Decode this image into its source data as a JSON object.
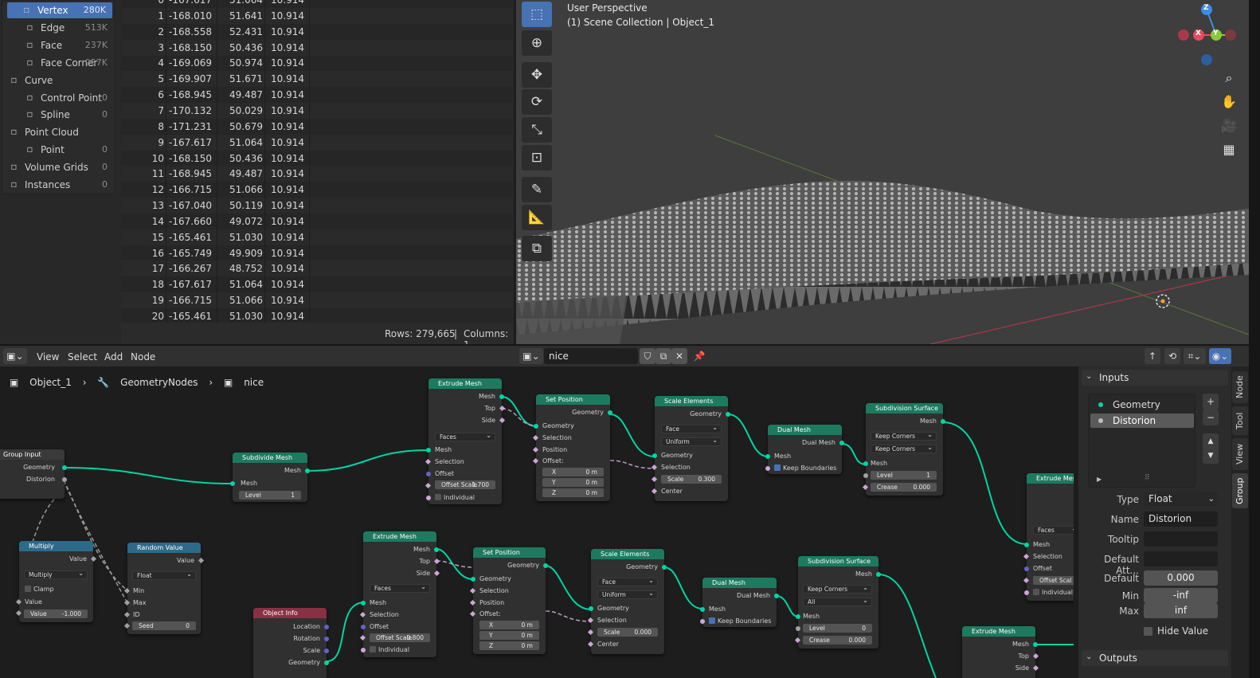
{
  "spreadsheet": {
    "domains": [
      {
        "label": "Vertex",
        "count": "280K",
        "icon": "vertex-icon",
        "indent": 1,
        "active": true
      },
      {
        "label": "Edge",
        "count": "513K",
        "icon": "edge-icon",
        "indent": 1
      },
      {
        "label": "Face",
        "count": "237K",
        "icon": "face-icon",
        "indent": 1
      },
      {
        "label": "Face Corner",
        "count": "957K",
        "icon": "face-corner-icon",
        "indent": 1
      },
      {
        "label": "Curve",
        "count": "",
        "icon": "curve-icon",
        "indent": 0
      },
      {
        "label": "Control Point",
        "count": "0",
        "icon": "control-point-icon",
        "indent": 1
      },
      {
        "label": "Spline",
        "count": "0",
        "icon": "spline-icon",
        "indent": 1
      },
      {
        "label": "Point Cloud",
        "count": "",
        "icon": "point-cloud-icon",
        "indent": 0
      },
      {
        "label": "Point",
        "count": "0",
        "icon": "point-icon",
        "indent": 1
      },
      {
        "label": "Volume Grids",
        "count": "0",
        "icon": "volume-icon",
        "indent": 0
      },
      {
        "label": "Instances",
        "count": "0",
        "icon": "instances-icon",
        "indent": 0
      }
    ],
    "rows": [
      [
        "0",
        "-167.617",
        "51.064",
        "10.914"
      ],
      [
        "1",
        "-168.010",
        "51.641",
        "10.914"
      ],
      [
        "2",
        "-168.558",
        "52.431",
        "10.914"
      ],
      [
        "3",
        "-168.150",
        "50.436",
        "10.914"
      ],
      [
        "4",
        "-169.069",
        "50.974",
        "10.914"
      ],
      [
        "5",
        "-169.907",
        "51.671",
        "10.914"
      ],
      [
        "6",
        "-168.945",
        "49.487",
        "10.914"
      ],
      [
        "7",
        "-170.132",
        "50.029",
        "10.914"
      ],
      [
        "8",
        "-171.231",
        "50.679",
        "10.914"
      ],
      [
        "9",
        "-167.617",
        "51.064",
        "10.914"
      ],
      [
        "10",
        "-168.150",
        "50.436",
        "10.914"
      ],
      [
        "11",
        "-168.945",
        "49.487",
        "10.914"
      ],
      [
        "12",
        "-166.715",
        "51.066",
        "10.914"
      ],
      [
        "13",
        "-167.040",
        "50.119",
        "10.914"
      ],
      [
        "14",
        "-167.660",
        "49.072",
        "10.914"
      ],
      [
        "15",
        "-165.461",
        "51.030",
        "10.914"
      ],
      [
        "16",
        "-165.749",
        "49.909",
        "10.914"
      ],
      [
        "17",
        "-166.267",
        "48.752",
        "10.914"
      ],
      [
        "18",
        "-167.617",
        "51.064",
        "10.914"
      ],
      [
        "19",
        "-166.715",
        "51.066",
        "10.914"
      ],
      [
        "20",
        "-165.461",
        "51.030",
        "10.914"
      ]
    ],
    "status_rows": "Rows: 279,665",
    "status_sep": "|",
    "status_cols": "Columns: 1"
  },
  "viewport": {
    "title": "User Perspective",
    "subtitle": "(1) Scene Collection | Object_1",
    "axis_x": "X",
    "axis_y": "Y",
    "axis_z": "Z",
    "colors": {
      "x": "#e44b5c",
      "y": "#8bc83a",
      "z": "#3b8ee8"
    }
  },
  "node_header": {
    "menus": [
      "View",
      "Select",
      "Add",
      "Node"
    ],
    "tree_name": "nice"
  },
  "breadcrumb": {
    "object": "Object_1",
    "modifier": "GeometryNodes",
    "tree": "nice"
  },
  "nodes": {
    "group_input": {
      "title": "Group Input",
      "out1": "Geometry",
      "out2": "Distorion"
    },
    "subdivide": {
      "title": "Subdivide Mesh",
      "out": "Mesh",
      "in": "Mesh",
      "level_k": "Level",
      "level_v": "1"
    },
    "extrude1": {
      "title": "Extrude Mesh",
      "out1": "Mesh",
      "out2": "Top",
      "out3": "Side",
      "mode": "Faces",
      "in1": "Mesh",
      "in2": "Selection",
      "in3": "Offset",
      "scale_k": "Offset Scale",
      "scale_v": "1.700",
      "individual": "Individual"
    },
    "setpos1": {
      "title": "Set Position",
      "out": "Geometry",
      "in1": "Geometry",
      "in2": "Selection",
      "in3": "Position",
      "in4": "Offset:",
      "x": "X",
      "y": "Y",
      "z": "Z",
      "xv": "0 m",
      "yv": "0 m",
      "zv": "0 m"
    },
    "scale1": {
      "title": "Scale Elements",
      "out": "Geometry",
      "dom": "Face",
      "mode": "Uniform",
      "in1": "Geometry",
      "in2": "Selection",
      "scale_k": "Scale",
      "scale_v": "0.300",
      "center": "Center"
    },
    "dual1": {
      "title": "Dual Mesh",
      "out": "Dual Mesh",
      "in": "Mesh",
      "keep": "Keep Boundaries"
    },
    "subsurf1": {
      "title": "Subdivision Surface",
      "out": "Mesh",
      "opt1": "Keep Corners",
      "opt2": "Keep Corners",
      "in": "Mesh",
      "level_k": "Level",
      "level_v": "1",
      "crease_k": "Crease",
      "crease_v": "0.000"
    },
    "extrude_r": {
      "title": "Extrude Mesh",
      "mode": "Faces",
      "in1": "Mesh",
      "in2": "Selection",
      "in3": "Offset",
      "scale_k": "Offset Scal",
      "individual": "Individual"
    },
    "multiply": {
      "title": "Multiply",
      "out": "Value",
      "op": "Multiply",
      "clamp": "Clamp",
      "in": "Value",
      "val_k": "Value",
      "val_v": "-1.000"
    },
    "random": {
      "title": "Random Value",
      "out": "Value",
      "type": "Float",
      "min": "Min",
      "max": "Max",
      "id": "ID",
      "seed_k": "Seed",
      "seed_v": "0"
    },
    "objinfo": {
      "title": "Object Info",
      "o1": "Location",
      "o2": "Rotation",
      "o3": "Scale",
      "o4": "Geometry"
    },
    "extrude2": {
      "title": "Extrude Mesh",
      "out1": "Mesh",
      "out2": "Top",
      "out3": "Side",
      "mode": "Faces",
      "in1": "Mesh",
      "in2": "Selection",
      "in3": "Offset",
      "scale_k": "Offset Scale",
      "scale_v": "-0.800",
      "individual": "Individual"
    },
    "setpos2": {
      "title": "Set Position",
      "out": "Geometry",
      "in1": "Geometry",
      "in2": "Selection",
      "in3": "Position",
      "in4": "Offset:",
      "x": "X",
      "y": "Y",
      "z": "Z",
      "xv": "0 m",
      "yv": "0 m",
      "zv": "0 m"
    },
    "scale2": {
      "title": "Scale Elements",
      "out": "Geometry",
      "dom": "Face",
      "mode": "Uniform",
      "in1": "Geometry",
      "in2": "Selection",
      "scale_k": "Scale",
      "scale_v": "0.000",
      "center": "Center"
    },
    "dual2": {
      "title": "Dual Mesh",
      "out": "Dual Mesh",
      "in": "Mesh",
      "keep": "Keep Boundaries"
    },
    "subsurf2": {
      "title": "Subdivision Surface",
      "out": "Mesh",
      "opt1": "Keep Corners",
      "opt2": "All",
      "in": "Mesh",
      "level_k": "Level",
      "level_v": "0",
      "crease_k": "Crease",
      "crease_v": "0.000"
    },
    "extrude3": {
      "title": "Extrude Mesh",
      "out1": "Mesh",
      "out2": "Top",
      "out3": "Side"
    }
  },
  "sidebar": {
    "inputs_title": "Inputs",
    "inputs": [
      "Geometry",
      "Distorion"
    ],
    "type_label": "Type",
    "type_value": "Float",
    "name_label": "Name",
    "name_value": "Distorion",
    "tooltip_label": "Tooltip",
    "tooltip_value": "",
    "default_attr_label": "Default Att...",
    "default_attr_value": "",
    "default_label": "Default",
    "default_value": "0.000",
    "min_label": "Min",
    "min_value": "-inf",
    "max_label": "Max",
    "max_value": "inf",
    "hide_value": "Hide Value",
    "outputs_title": "Outputs",
    "tabs": [
      "Node",
      "Tool",
      "View",
      "Group"
    ]
  }
}
